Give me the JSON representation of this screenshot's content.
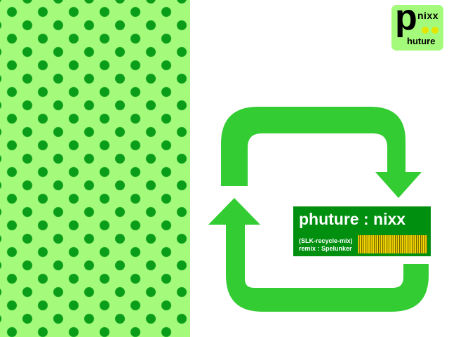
{
  "colors": {
    "panel_bg": "#a4fb7b",
    "dot": "#0a9d1a",
    "arrow": "#33cc33",
    "label_bg": "#008f0f",
    "logo_dot": "#e5e600",
    "barcode": "#e0c400"
  },
  "logo": {
    "letter": "p",
    "top_text": "nixx",
    "bottom_text": "huture",
    "icon": "phuture-nixx-logo"
  },
  "artwork": {
    "icon": "recycle-arrows-icon",
    "pattern": "polka-dot-pattern"
  },
  "label": {
    "title": "phuture : nixx",
    "line1": "(SLK-recycle-mix)",
    "line2": "remix : Spelunker",
    "barcode_icon": "barcode-icon"
  }
}
